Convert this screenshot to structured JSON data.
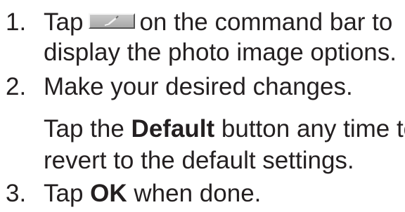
{
  "steps": [
    {
      "number": "1.",
      "line1_pre": "Tap",
      "line1_icon": "edit-pencil-icon",
      "line1_post": "on the command bar to",
      "line2": "display the photo image options."
    },
    {
      "number": "2.",
      "line1": "Make your desired changes.",
      "note_pre": "Tap the",
      "note_bold": "Default",
      "note_post": "button any time to",
      "note_line2": "revert to the default settings."
    },
    {
      "number": "3.",
      "line1_pre": "Tap",
      "line1_bold": "OK",
      "line1_post": "when done."
    }
  ]
}
